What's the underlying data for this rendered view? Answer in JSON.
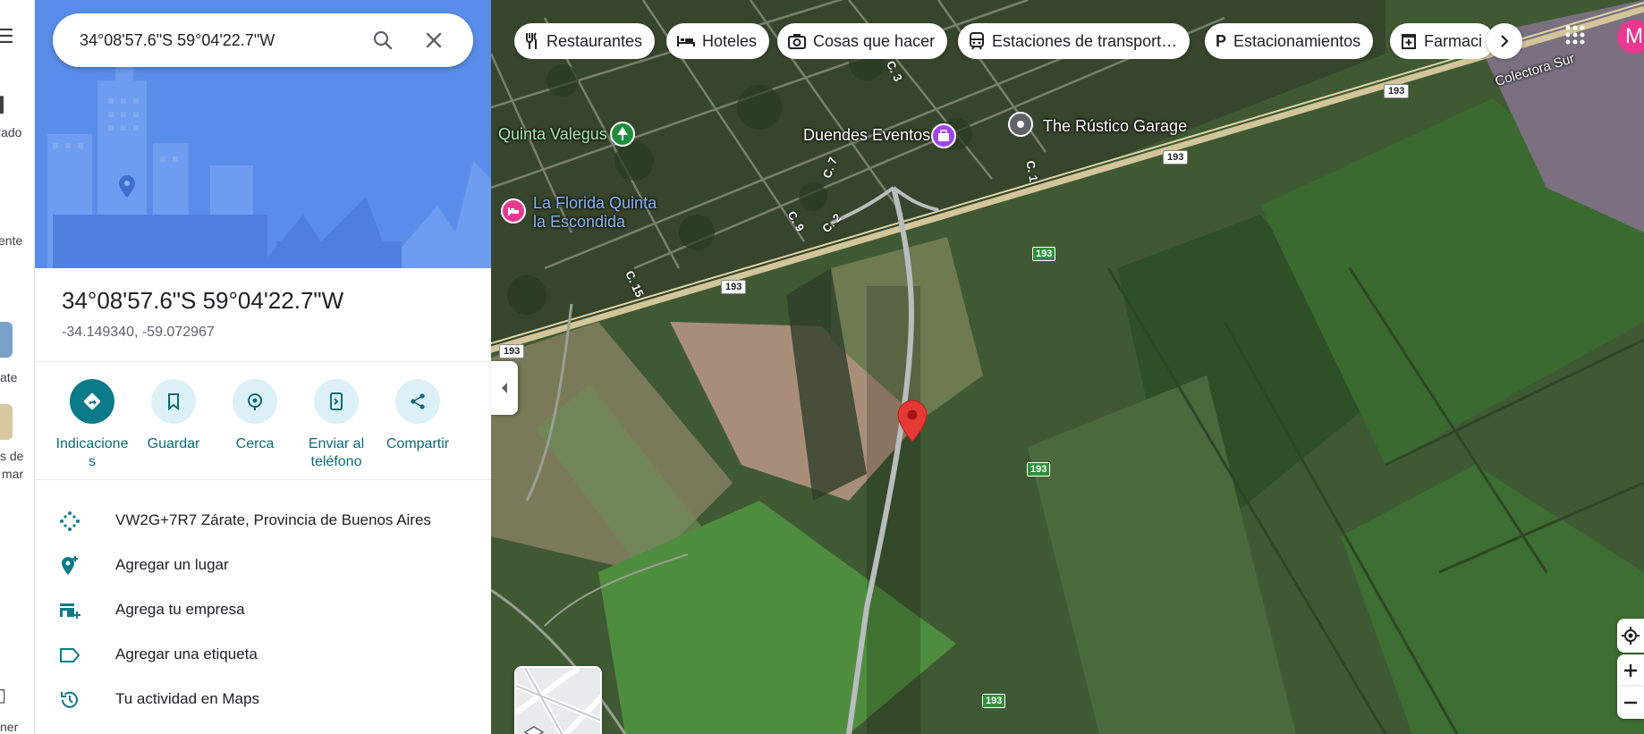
{
  "search": {
    "value": "34°08'57.6\"S 59°04'22.7\"W"
  },
  "rail": {
    "items": [
      {
        "label": "lado"
      },
      {
        "label": "ente"
      },
      {
        "label": "ate"
      },
      {
        "label": "s de"
      },
      {
        "label": "mar"
      },
      {
        "label": "ner"
      }
    ]
  },
  "place": {
    "title": "34°08'57.6\"S 59°04'22.7\"W",
    "coords": "-34.149340, -59.072967"
  },
  "actions": [
    {
      "label_l1": "Indicacione",
      "label_l2": "s",
      "icon": "directions-icon"
    },
    {
      "label_l1": "Guardar",
      "label_l2": "",
      "icon": "bookmark-icon"
    },
    {
      "label_l1": "Cerca",
      "label_l2": "",
      "icon": "nearby-icon"
    },
    {
      "label_l1": "Enviar al",
      "label_l2": "teléfono",
      "icon": "send-to-phone-icon"
    },
    {
      "label_l1": "Compartir",
      "label_l2": "",
      "icon": "share-icon"
    }
  ],
  "info_rows": [
    {
      "text": "VW2G+7R7 Zárate, Provincia de Buenos Aires",
      "icon": "plus-code-icon"
    },
    {
      "text": "Agregar un lugar",
      "icon": "add-place-icon"
    },
    {
      "text": "Agrega tu empresa",
      "icon": "add-business-icon"
    },
    {
      "text": "Agregar una etiqueta",
      "icon": "label-icon"
    },
    {
      "text": "Tu actividad en Maps",
      "icon": "history-icon"
    }
  ],
  "chips": [
    {
      "label": "Restaurantes",
      "icon": "restaurant-icon"
    },
    {
      "label": "Hoteles",
      "icon": "hotel-icon"
    },
    {
      "label": "Cosas que hacer",
      "icon": "camera-icon"
    },
    {
      "label": "Estaciones de transport…",
      "icon": "transit-icon"
    },
    {
      "label": "Estacionamientos",
      "icon": "parking-icon"
    },
    {
      "label": "Farmaci",
      "icon": "pharmacy-icon"
    }
  ],
  "map_labels": {
    "quinta_valegus": "Quinta Valegus",
    "duendes": "Duendes Eventos",
    "rustico": "The Rústico Garage",
    "la_florida_1": "La Florida Quinta",
    "la_florida_2": "la Escondida",
    "colectora": "Colectora Sur"
  },
  "streets": {
    "c3": "C. 3",
    "c7": "C. 7",
    "c9": "C. 9",
    "c2": "C. 2",
    "c1": "C. 1",
    "c15": "C. 15"
  },
  "route_shields": {
    "r193": "193"
  },
  "user": {
    "initial": "M",
    "color": "#e8388f"
  },
  "colors": {
    "accent_teal": "#0b7a89",
    "hero_blue": "#5a8de9",
    "pin_red": "#e53935"
  }
}
